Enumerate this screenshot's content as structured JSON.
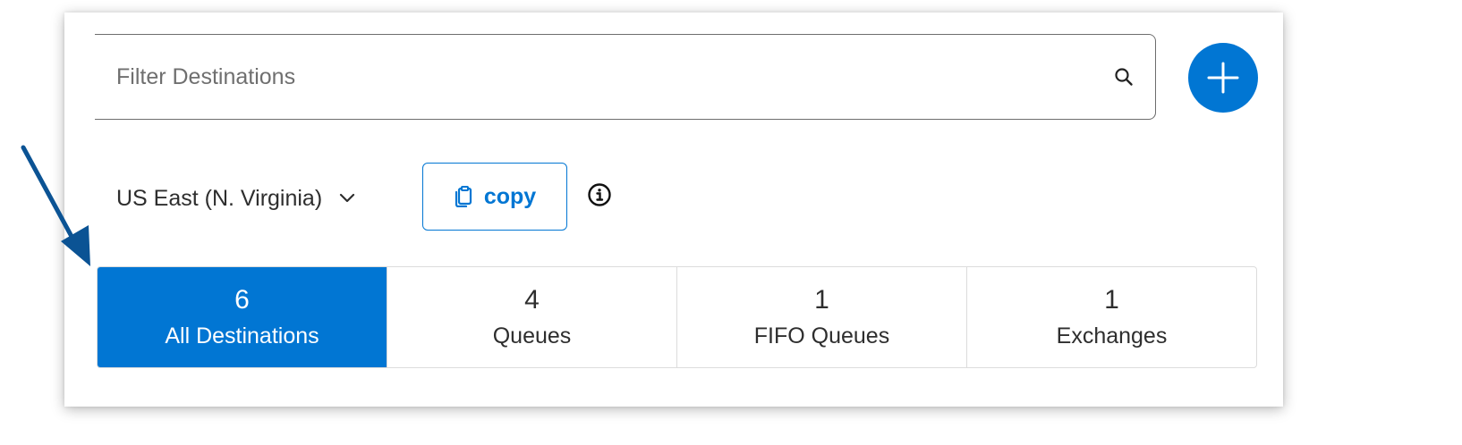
{
  "search": {
    "placeholder": "Filter Destinations",
    "value": ""
  },
  "add_button": {
    "icon": "plus-icon"
  },
  "region": {
    "selected": "US East (N. Virginia)",
    "icon": "chevron-down-icon"
  },
  "copy_button": {
    "label": "copy",
    "icon": "clipboard-icon"
  },
  "info": {
    "icon": "info-icon"
  },
  "tabs": [
    {
      "count": "6",
      "label": "All Destinations",
      "active": true
    },
    {
      "count": "4",
      "label": "Queues",
      "active": false
    },
    {
      "count": "1",
      "label": "FIFO Queues",
      "active": false
    },
    {
      "count": "1",
      "label": "Exchanges",
      "active": false
    }
  ],
  "annotation": {
    "icon": "arrow-icon",
    "color": "#0b5394"
  },
  "colors": {
    "accent": "#0176d3",
    "text": "#2e2e2e",
    "border": "#dcdcdc"
  }
}
